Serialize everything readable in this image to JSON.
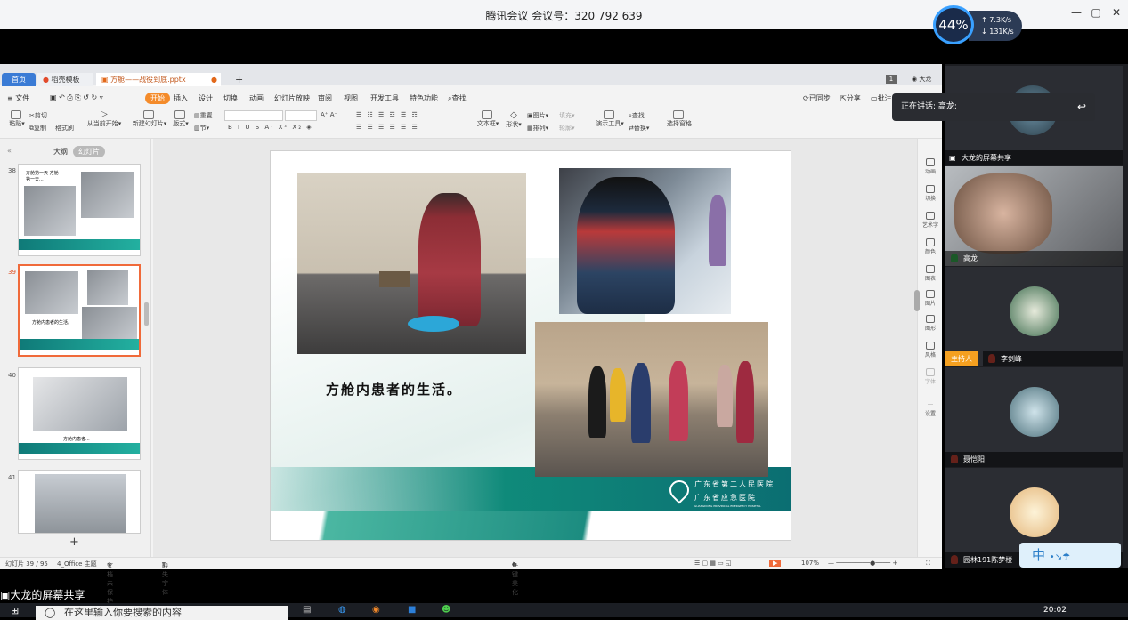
{
  "meeting": {
    "title": "腾讯会议 会议号：320 792 639",
    "net_percent": "44%",
    "upload": "7.3K/s",
    "download": "131K/s"
  },
  "wps": {
    "tabs": [
      {
        "label": "首页"
      },
      {
        "label": "稻壳模板"
      },
      {
        "label": "方舱——战役到底.pptx"
      }
    ],
    "window_badge": "1",
    "user_name": "大龙",
    "menu": [
      "文件",
      "开始",
      "插入",
      "设计",
      "切换",
      "动画",
      "幻灯片放映",
      "审阅",
      "视图",
      "开发工具",
      "特色功能",
      "查找"
    ],
    "menu_right": [
      "已同步",
      "分享",
      "批注"
    ],
    "ribbon": {
      "paste": "粘贴",
      "cut": "剪切",
      "copy": "复制",
      "format_painter": "格式刷",
      "play_from_current": "从当前开始",
      "new_slide": "新建幻灯片",
      "layout": "版式",
      "reset": "重置",
      "section": "节",
      "text_box": "文本框",
      "shape": "形状",
      "picture": "图片",
      "fill": "填充",
      "arrange": "排列",
      "outline": "轮廓",
      "presentation_tools": "演示工具",
      "find": "查找",
      "replace": "替换",
      "select_pane": "选择窗格"
    },
    "left_panel": {
      "tabs": [
        "大纲",
        "幻灯片"
      ],
      "slides": [
        {
          "num": "38",
          "caption": "方舱第一天 方舱第一天..."
        },
        {
          "num": "39",
          "caption": "方舱内患者的生活。"
        },
        {
          "num": "40",
          "caption": "方舱内患者..."
        },
        {
          "num": "41",
          "caption": ""
        }
      ],
      "add": "+"
    },
    "slide": {
      "caption": "方舱内患者的生活。",
      "logo_line1": "广东省第二人民医院",
      "logo_line2": "广东省应急医院",
      "logo_line3": "GUANGDONG PROVINCIAL EMERGENCY HOSPITAL"
    },
    "right_tools": [
      "动画",
      "切换",
      "艺术字",
      "颜色",
      "图表",
      "图片",
      "图形",
      "风格",
      "字体",
      "设置"
    ],
    "status": {
      "slide_counter": "幻灯片 39 / 95",
      "theme": "4_Office 主题",
      "doc_protect": "文档未保护",
      "missing_font": "缺失字体",
      "beautify": "一键美化",
      "zoom": "107%"
    }
  },
  "participants": {
    "speaking": "正在讲话: 高龙;",
    "share_title": "大龙的屏幕共享",
    "tiles": [
      {
        "name": "大龙的屏幕共享"
      },
      {
        "name": "高龙"
      },
      {
        "name": "李剑峰",
        "host": "主持人"
      },
      {
        "name": "聂恺阳"
      },
      {
        "name": "园林191陈梦楼"
      }
    ]
  },
  "bottom": {
    "share_label": "大龙的屏幕共享",
    "search_placeholder": "在这里输入你要搜索的内容",
    "time": "20:02",
    "ime": "中"
  },
  "colors": {
    "accent_orange": "#f48b2a",
    "teal": "#0f8a7a",
    "wps_blue": "#3a7bd5"
  }
}
